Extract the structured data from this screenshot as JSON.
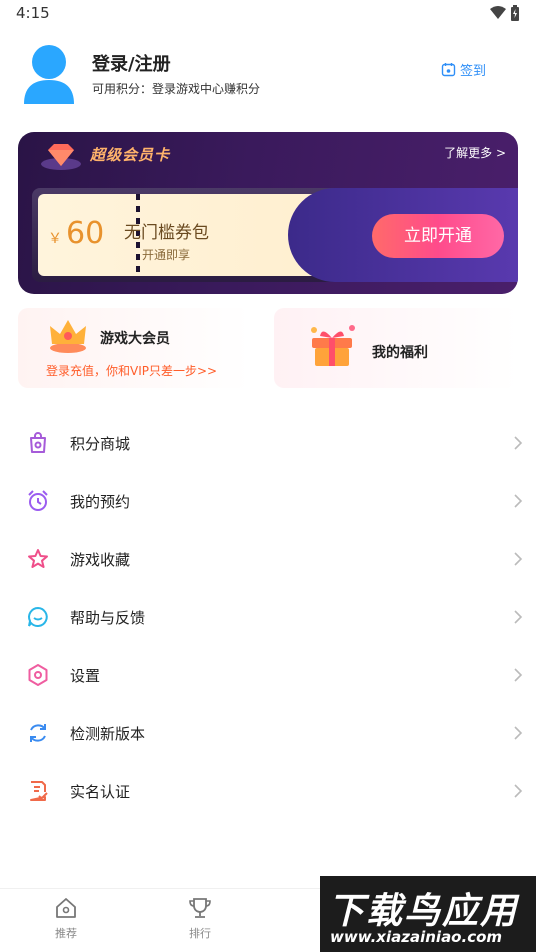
{
  "status_bar": {
    "time": "4:15"
  },
  "profile": {
    "name": "登录/注册",
    "points_line": "可用积分：登录游戏中心赚积分",
    "checkin_label": "签到"
  },
  "vip_card": {
    "title": "超级会员卡",
    "more_label": "了解更多 >",
    "currency": "￥",
    "price": "60",
    "coupon_title": "无门槛券包",
    "coupon_sub": "开通即享",
    "open_button": "立即开通"
  },
  "feature_cards": {
    "game_vip": {
      "title": "游戏大会员",
      "subtitle": "登录充值，你和VIP只差一步>>"
    },
    "welfare": {
      "title": "我的福利"
    }
  },
  "menu": [
    {
      "label": "积分商城",
      "icon": "shopping-bag-icon",
      "color": "#a65bd9"
    },
    {
      "label": "我的预约",
      "icon": "alarm-clock-icon",
      "color": "#9b5cf0"
    },
    {
      "label": "游戏收藏",
      "icon": "star-icon",
      "color": "#ef4f8a"
    },
    {
      "label": "帮助与反馈",
      "icon": "chat-bubble-icon",
      "color": "#29b6e8"
    },
    {
      "label": "设置",
      "icon": "hexagon-settings-icon",
      "color": "#ef5da0"
    },
    {
      "label": "检测新版本",
      "icon": "refresh-icon",
      "color": "#3a8bf0"
    },
    {
      "label": "实名认证",
      "icon": "id-document-icon",
      "color": "#f06a4a"
    }
  ],
  "tab_bar": [
    {
      "label": "推荐",
      "icon": "home-icon"
    },
    {
      "label": "排行",
      "icon": "trophy-icon"
    }
  ],
  "watermark": {
    "line1": "下载鸟应用",
    "line2": "www.xiazainiao.com"
  }
}
